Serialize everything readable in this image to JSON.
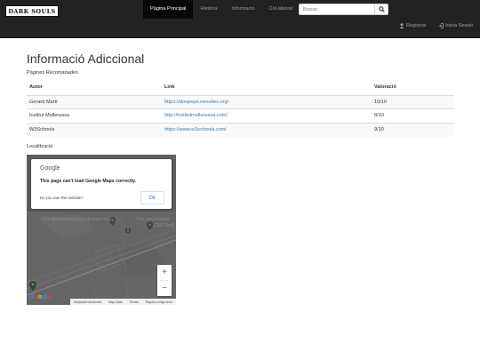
{
  "brand": "DARK SOULS",
  "nav": {
    "items": [
      "Pàgina Principal",
      "Història",
      "Informació",
      "Col·labora!"
    ],
    "search_placeholder": "Buscar",
    "right": [
      "Registrar",
      "Inicia Sessió"
    ]
  },
  "page": {
    "title": "Informació Adiccional",
    "subtitle": "Pàgines Recomanades",
    "location_label": "Localització"
  },
  "table": {
    "headers": [
      "Autor",
      "Link",
      "Valoració"
    ],
    "rows": [
      [
        "Gerard Martí",
        "https://donpepe.neocites.org/",
        "10/10"
      ],
      [
        "Institut Mollerussa",
        "http://institutmollerussa.com/",
        "8/10"
      ],
      [
        "W3Schools",
        "https://www.w3schools.com/",
        "9/10"
      ]
    ]
  },
  "map": {
    "google": "Google",
    "error": "This page can't load Google Maps correctly.",
    "own_website": "Do you own this website?",
    "ok": "OK",
    "dev_text_1": "For development purposes only",
    "dev_text_2": "For developme",
    "place_label": "CEE Siroll",
    "zoom_in": "+",
    "zoom_out": "−",
    "footer": [
      "Keyboard shortcuts",
      "Map Data",
      "Terms",
      "Report a map error"
    ]
  }
}
